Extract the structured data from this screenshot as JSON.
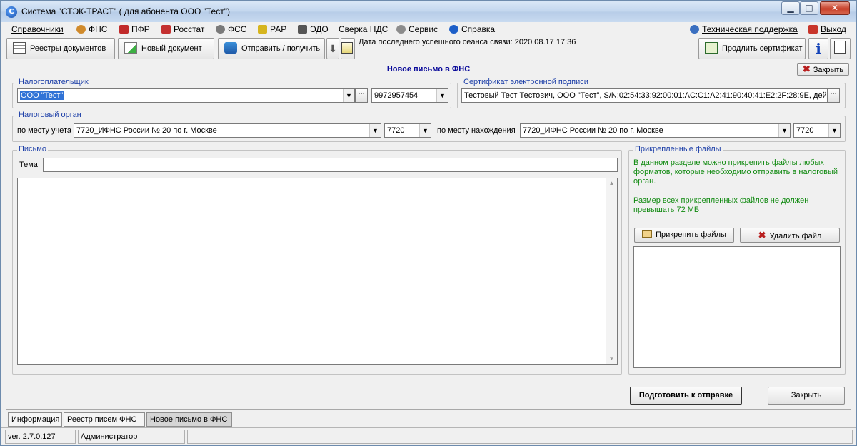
{
  "window": {
    "title": "Система \"СТЭК-ТРАСТ\" ( для абонента ООО \"Тест\")",
    "app_icon_glyph": "С",
    "minimize_glyph": "▁",
    "maximize_glyph": "□",
    "close_glyph": "✕"
  },
  "menu": {
    "items": [
      "Справочники",
      "ФНС",
      "ПФР",
      "Росстат",
      "ФСС",
      "РАР",
      "ЭДО",
      "Сверка НДС",
      "Сервис",
      "Справка"
    ],
    "support": "Техническая поддержка",
    "exit": "Выход",
    "icon_colors": {
      "fns": "#d08a2b",
      "pfr": "#c12a2a",
      "rosstat": "#c43030",
      "fss": "#7a7a7a",
      "rar": "#d6b51e",
      "edo": "#555555",
      "service": "#8c8c8c",
      "help": "#1d5fc8",
      "support": "#3a6fc0",
      "exit": "#c8352a"
    }
  },
  "toolbar": {
    "registers": "Реестры документов",
    "new_doc": "Новый документ",
    "send_receive": "Отправить / получить",
    "last_session": "Дата последнего успешного сеанса связи: 2020.08.17 17:36",
    "extend_cert": "Продлить сертификат",
    "info_glyph": "i",
    "arrow_down_glyph": "⬇"
  },
  "panel": {
    "title": "Новое письмо в ФНС",
    "close_top": "Закрыть"
  },
  "taxpayer": {
    "label": "Налогоплательщик",
    "name": "ООО \"Тест\"",
    "inn": "9972957454"
  },
  "certificate": {
    "label": "Сертификат электронной подписи",
    "value": "Тестовый Тест Тестович, ООО \"Тест\", S/N:02:54:33:92:00:01:AC:C1:A2:41:90:40:41:E2:2F:28:9E, дей"
  },
  "tax_authority": {
    "label": "Налоговый орган",
    "registration_label": "по месту учета",
    "registration_value": "7720_ИФНС России № 20 по г. Москве",
    "registration_code": "7720",
    "location_label": "по месту нахождения",
    "location_value": "7720_ИФНС России № 20 по г. Москве",
    "location_code": "7720"
  },
  "letter": {
    "label": "Письмо",
    "subject_label": "Тема",
    "subject_value": "",
    "body": ""
  },
  "attachments": {
    "label": "Прикрепленные файлы",
    "info1": "В данном разделе можно прикрепить файлы любых форматов, которые необходимо отправить в налоговый орган.",
    "info2": "Размер всех прикрепленных файлов не должен превышать 72 МБ",
    "attach_button": "Прикрепить файлы",
    "delete_button": "Удалить файл"
  },
  "footer_buttons": {
    "prepare": "Подготовить к отправке",
    "close": "Закрыть"
  },
  "tabs": [
    "Информация",
    "Реестр писем ФНС",
    "Новое письмо в ФНС"
  ],
  "status": {
    "version": "ver. 2.7.0.127",
    "user": "Администратор"
  }
}
